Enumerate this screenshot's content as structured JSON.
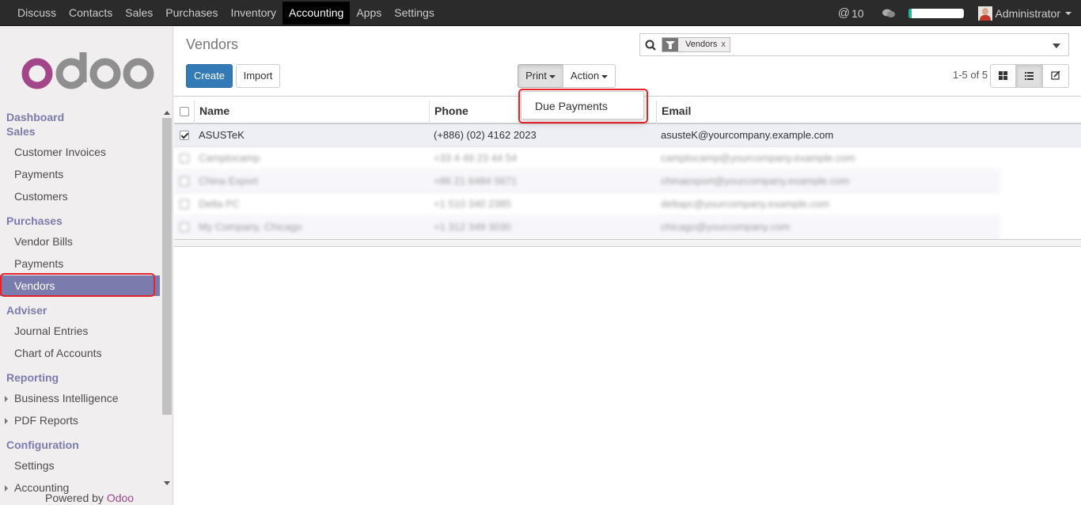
{
  "topbar": {
    "menu": [
      "Discuss",
      "Contacts",
      "Sales",
      "Purchases",
      "Inventory",
      "Accounting",
      "Apps",
      "Settings"
    ],
    "active_menu": "Accounting",
    "at_symbol": "@",
    "notification_count": "10",
    "progress_percent": 7,
    "user": "Administrator"
  },
  "sidebar": {
    "brand": "odoo",
    "sections": [
      {
        "label": "Dashboard",
        "items": []
      },
      {
        "label": "Sales",
        "items": [
          "Customer Invoices",
          "Payments",
          "Customers"
        ]
      },
      {
        "label": "Purchases",
        "items": [
          "Vendor Bills",
          "Payments",
          "Vendors"
        ]
      },
      {
        "label": "Adviser",
        "items": [
          "Journal Entries",
          "Chart of Accounts"
        ]
      },
      {
        "label": "Reporting",
        "items": [
          "Business Intelligence",
          "PDF Reports"
        ]
      },
      {
        "label": "Configuration",
        "items": [
          "Settings",
          "Accounting"
        ]
      }
    ],
    "active_item": "Vendors",
    "powered_by": "Powered by",
    "powered_brand": "Odoo"
  },
  "control": {
    "breadcrumb": "Vendors",
    "create": "Create",
    "import": "Import",
    "print": "Print",
    "action": "Action",
    "pager": "1-5 of 5",
    "search_facet": "Vendors",
    "facet_remove": "x"
  },
  "dropdown": {
    "items": [
      "Due Payments"
    ]
  },
  "table": {
    "columns": [
      "Name",
      "Phone",
      "Email"
    ],
    "rows": [
      {
        "name": "ASUSTeK",
        "phone": "(+886) (02) 4162 2023",
        "email": "asusteK@yourcompany.example.com",
        "checked": true
      },
      {
        "name": "Camptocamp",
        "phone": "+33 4 49 23 44 54",
        "email": "camptocamp@yourcompany.example.com",
        "checked": false
      },
      {
        "name": "China Export",
        "phone": "+86 21 6484 5671",
        "email": "chinaexport@yourcompany.example.com",
        "checked": false
      },
      {
        "name": "Delta PC",
        "phone": "+1 510 340 2385",
        "email": "deltapc@yourcompany.example.com",
        "checked": false
      },
      {
        "name": "My Company, Chicago",
        "phone": "+1 312 349 3030",
        "email": "chicago@yourcompany.com",
        "checked": false
      }
    ]
  },
  "colors": {
    "topbar": "#2b2b2b",
    "accent": "#7c7bad",
    "primary_button": "#337ab7",
    "highlight": "#e3242b",
    "brand": "#a24689"
  }
}
